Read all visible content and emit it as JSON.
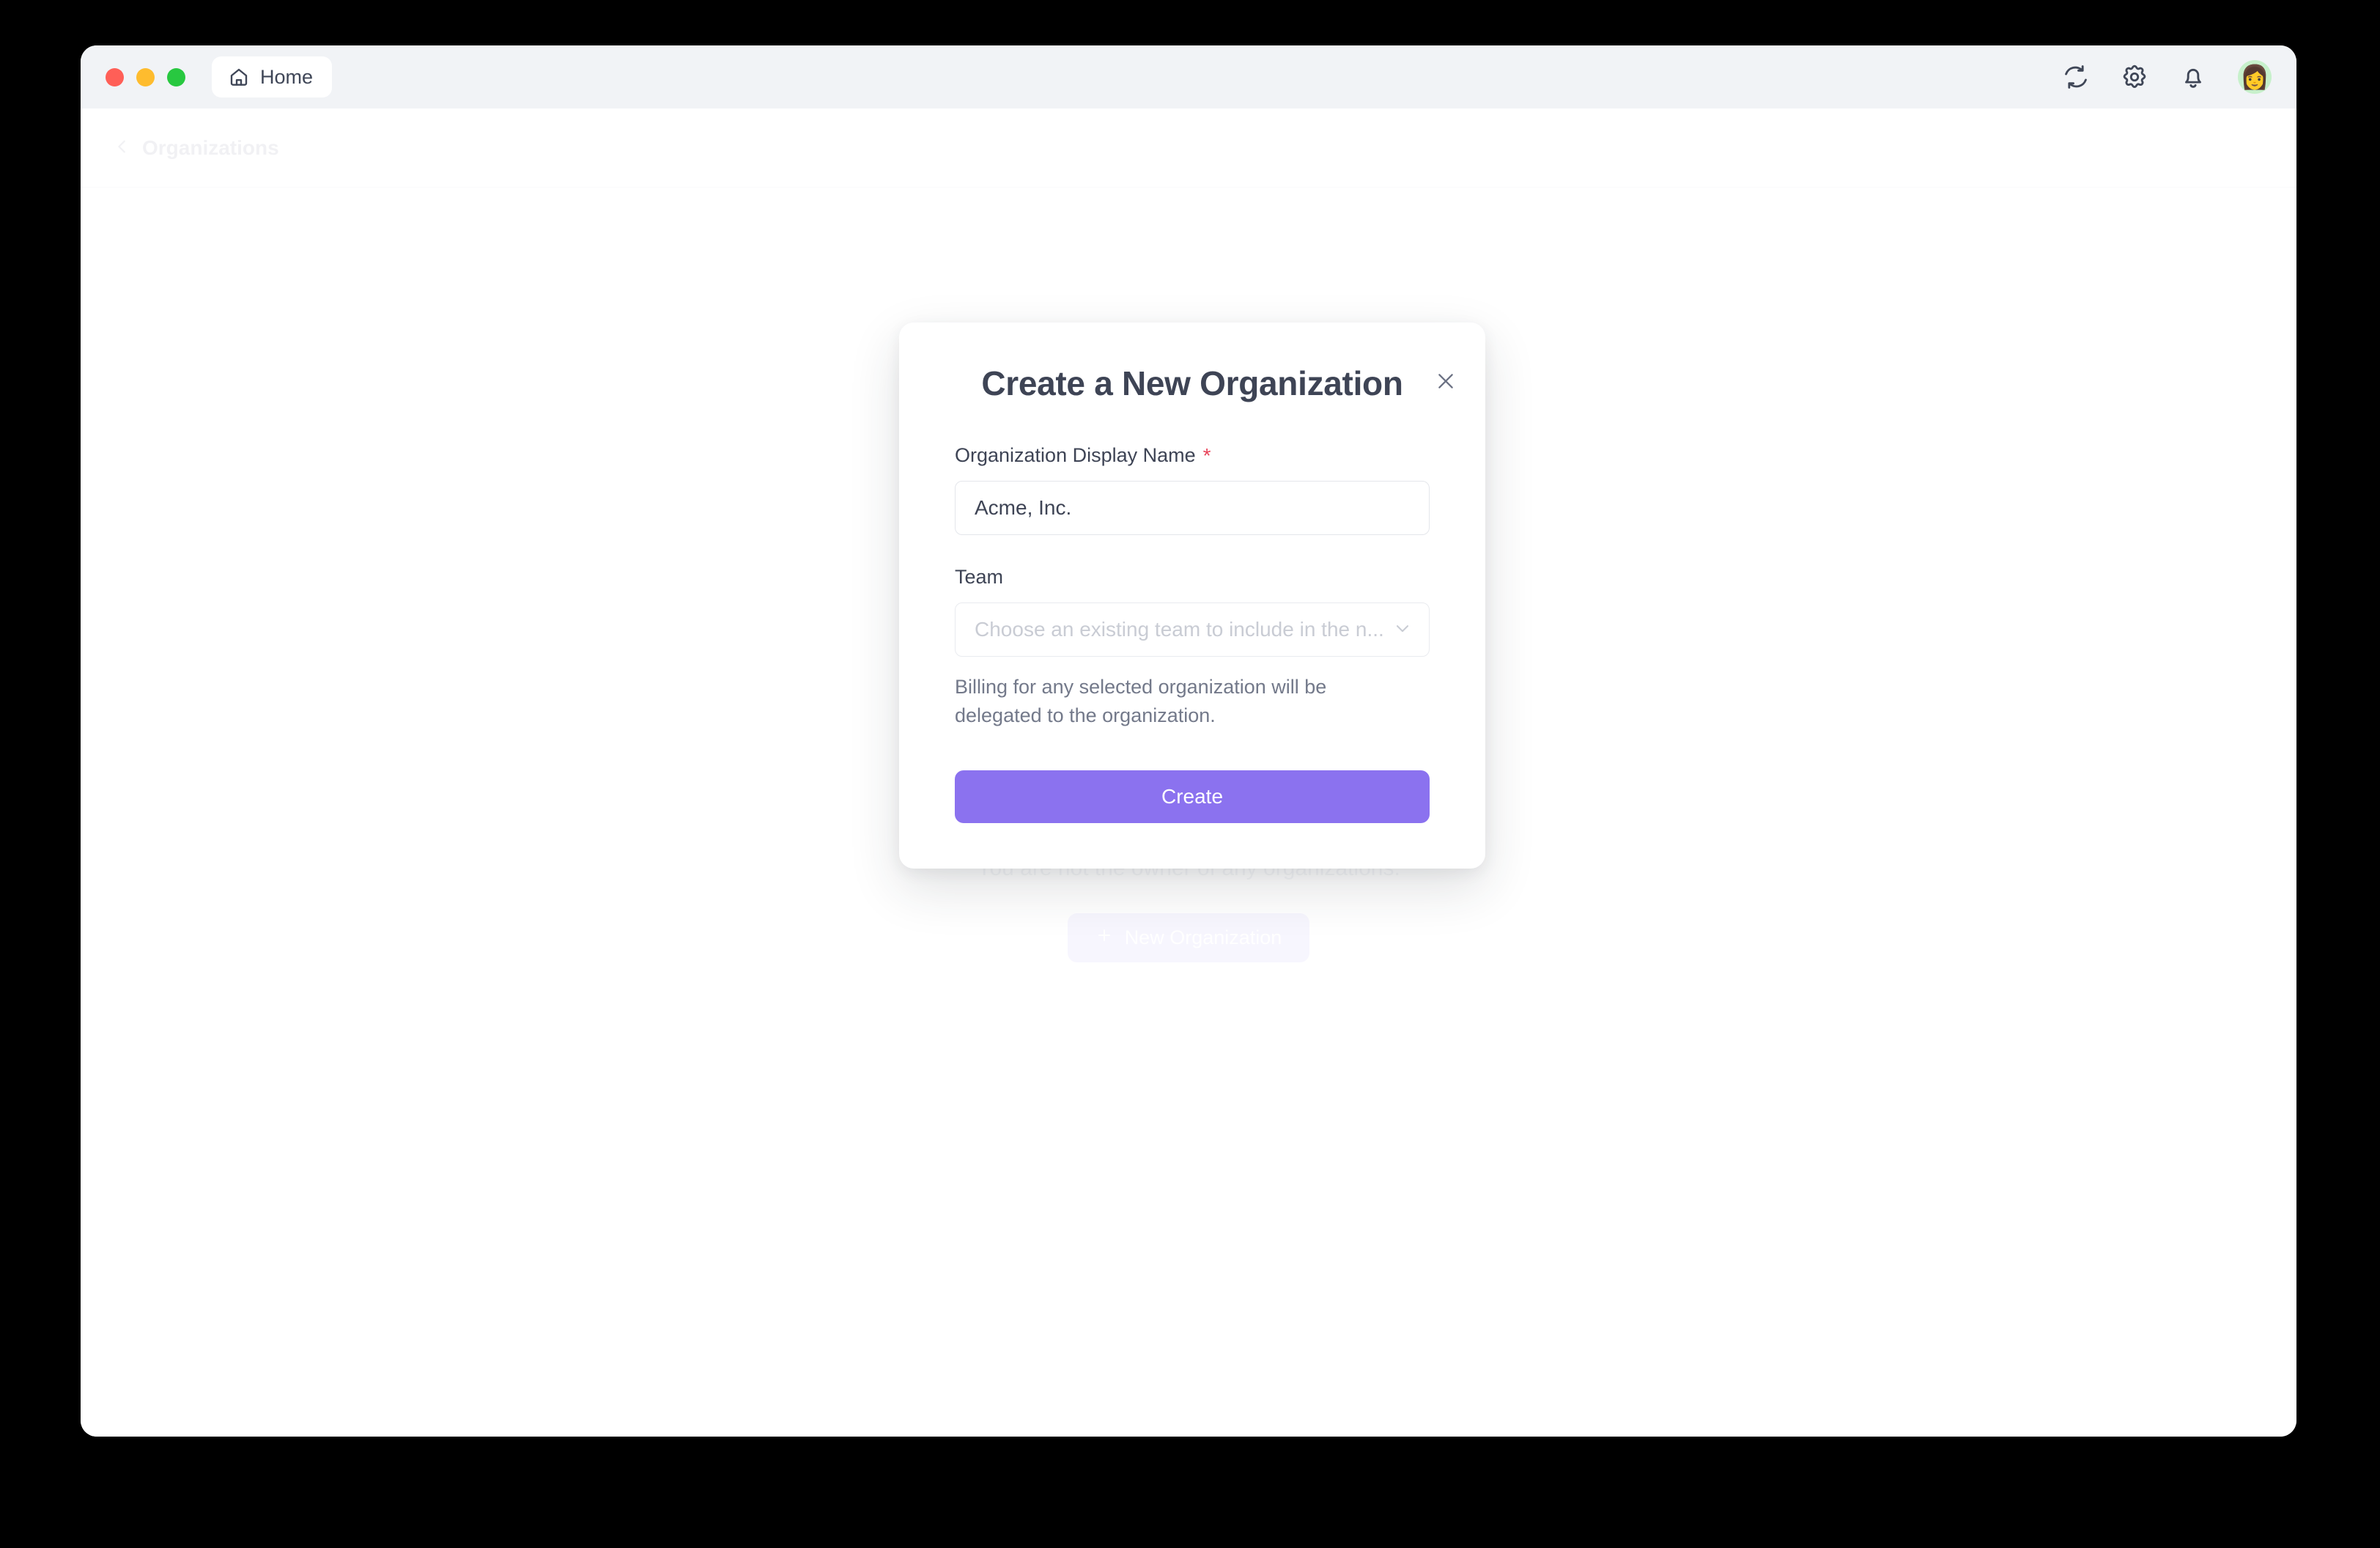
{
  "window": {
    "titlebar": {
      "traffic_lights": [
        "close",
        "minimize",
        "maximize"
      ],
      "tab_label": "Home",
      "actions": [
        "refresh-icon",
        "gear-icon",
        "bell-icon"
      ],
      "avatar_emoji": "👩"
    }
  },
  "breadcrumb": {
    "back_icon": "chevron-left-icon",
    "label": "Organizations"
  },
  "background": {
    "empty_state_text": "You are not the owner of any organizations.",
    "new_org_button_label": "New Organization",
    "new_org_button_icon": "plus-icon"
  },
  "modal": {
    "title": "Create a New Organization",
    "close_icon": "close-icon",
    "fields": {
      "display_name": {
        "label": "Organization Display Name",
        "required_marker": "*",
        "value": "Acme, Inc.",
        "placeholder": "Acme, Inc."
      },
      "team": {
        "label": "Team",
        "placeholder": "Choose an existing team to include in the n...",
        "chevron_icon": "chevron-down-icon",
        "helper_text": "Billing for any selected organization will be delegated to the organization."
      }
    },
    "submit_label": "Create"
  },
  "colors": {
    "accent": "#8b72ef",
    "accent_muted": "#e3ddf9",
    "required": "#e8445a",
    "titlebar": "#f1f3f6",
    "text_primary": "#3e4455",
    "text_muted": "#73798a",
    "text_disabled": "#c9ccd4"
  }
}
